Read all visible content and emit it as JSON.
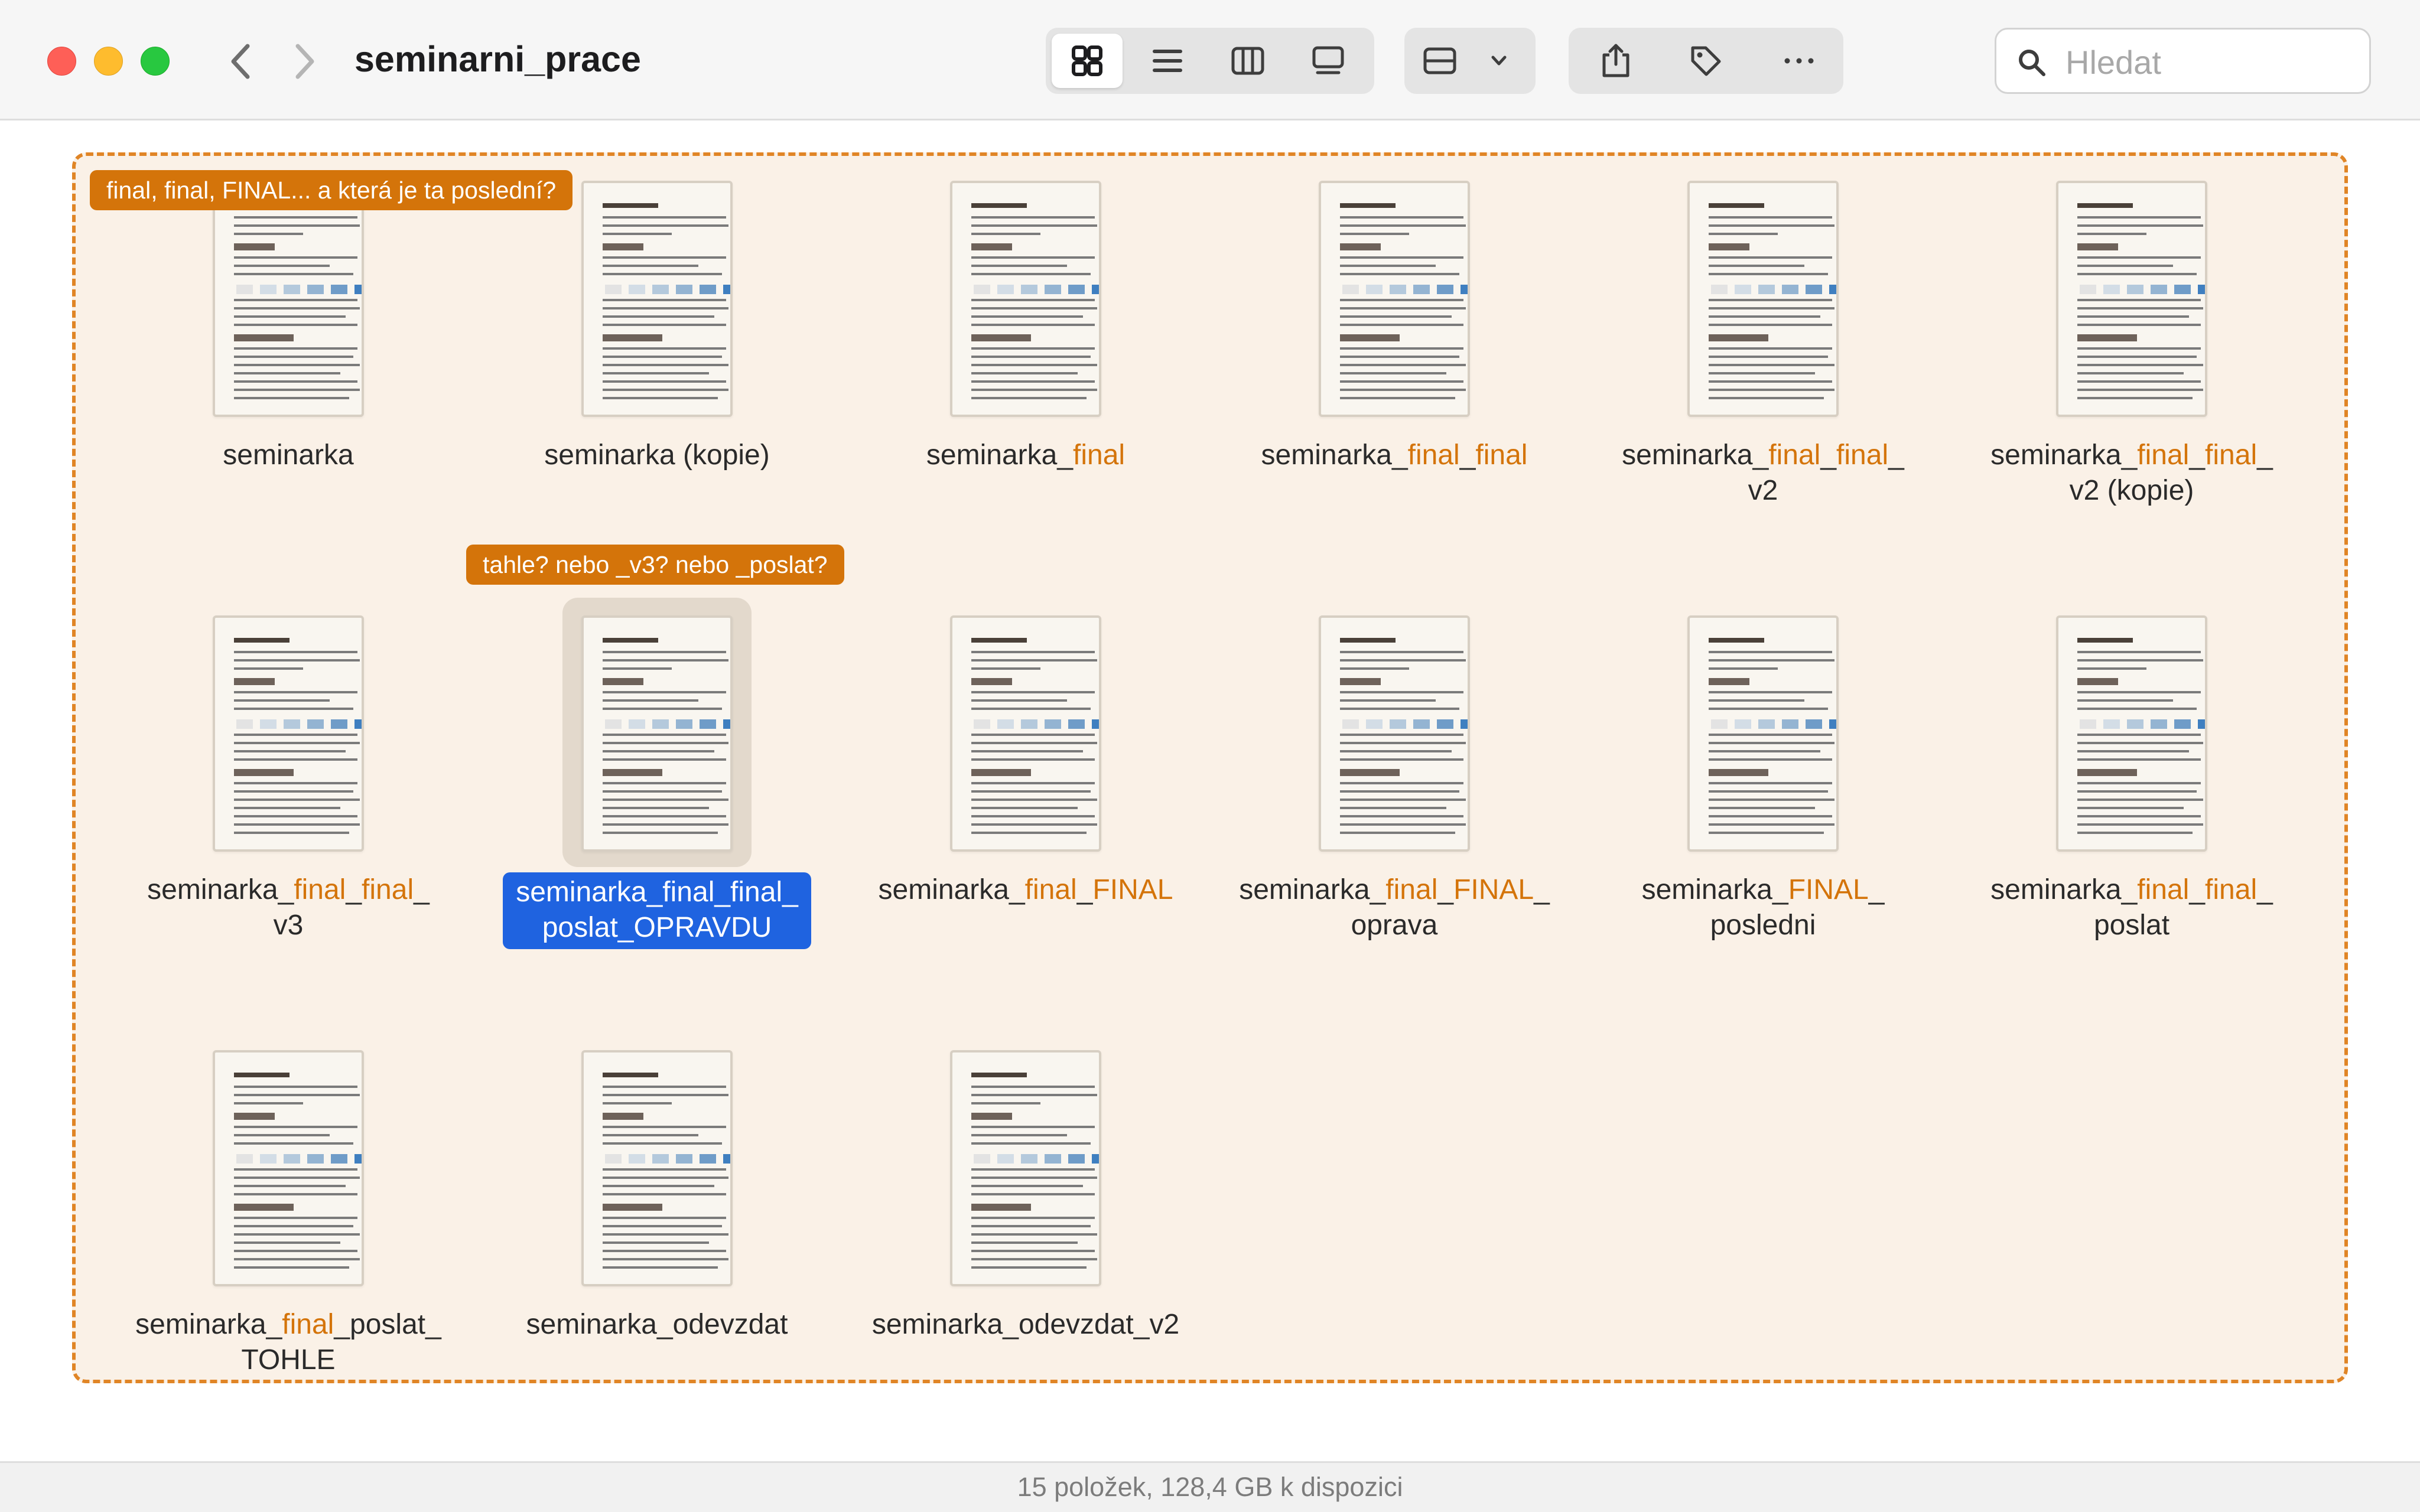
{
  "window": {
    "title": "seminarni_prace",
    "toolbar": {
      "view_buttons": [
        {
          "name": "icon-view",
          "icon": "grid-icon",
          "selected": true
        },
        {
          "name": "list-view",
          "icon": "list-icon",
          "selected": false
        },
        {
          "name": "column-view",
          "icon": "columns-icon",
          "selected": false
        },
        {
          "name": "gallery-view",
          "icon": "gallery-icon",
          "selected": false
        }
      ],
      "group_icon": "group-by-icon",
      "actions": [
        "share-icon",
        "tag-icon",
        "more-icon"
      ]
    },
    "search": {
      "placeholder": "Hledat",
      "value": ""
    }
  },
  "callouts": {
    "top": "final, final, FINAL... a která je ta poslední?",
    "middle": "tahle? nebo _v3? nebo _poslat?"
  },
  "files": [
    {
      "lines": [
        [
          {
            "t": "seminarka",
            "h": false
          }
        ]
      ]
    },
    {
      "lines": [
        [
          {
            "t": "seminarka (kopie)",
            "h": false
          }
        ]
      ]
    },
    {
      "lines": [
        [
          {
            "t": "seminarka_",
            "h": false
          },
          {
            "t": "final",
            "h": true
          }
        ]
      ]
    },
    {
      "lines": [
        [
          {
            "t": "seminarka_",
            "h": false
          },
          {
            "t": "final",
            "h": true
          },
          {
            "t": "_",
            "h": false
          },
          {
            "t": "final",
            "h": true
          }
        ]
      ]
    },
    {
      "lines": [
        [
          {
            "t": "seminarka_",
            "h": false
          },
          {
            "t": "final",
            "h": true
          },
          {
            "t": "_",
            "h": false
          },
          {
            "t": "final",
            "h": true
          },
          {
            "t": "_",
            "h": false
          }
        ],
        [
          {
            "t": "v2",
            "h": false
          }
        ]
      ]
    },
    {
      "lines": [
        [
          {
            "t": "seminarka_",
            "h": false
          },
          {
            "t": "final",
            "h": true
          },
          {
            "t": "_",
            "h": false
          },
          {
            "t": "final",
            "h": true
          },
          {
            "t": "_",
            "h": false
          }
        ],
        [
          {
            "t": "v2 (kopie)",
            "h": false
          }
        ]
      ]
    },
    {
      "lines": [
        [
          {
            "t": "seminarka_",
            "h": false
          },
          {
            "t": "final",
            "h": true
          },
          {
            "t": "_",
            "h": false
          },
          {
            "t": "final",
            "h": true
          },
          {
            "t": "_",
            "h": false
          }
        ],
        [
          {
            "t": "v3",
            "h": false
          }
        ]
      ]
    },
    {
      "lines": [
        [
          {
            "t": "seminarka_final_final_",
            "h": false
          }
        ],
        [
          {
            "t": "poslat_OPRAVDU",
            "h": false
          }
        ]
      ],
      "selected": true
    },
    {
      "lines": [
        [
          {
            "t": "seminarka_",
            "h": false
          },
          {
            "t": "final",
            "h": true
          },
          {
            "t": "_",
            "h": false
          },
          {
            "t": "FINAL",
            "h": true
          }
        ]
      ]
    },
    {
      "lines": [
        [
          {
            "t": "seminarka_",
            "h": false
          },
          {
            "t": "final",
            "h": true
          },
          {
            "t": "_",
            "h": false
          },
          {
            "t": "FINAL",
            "h": true
          },
          {
            "t": "_",
            "h": false
          }
        ],
        [
          {
            "t": "oprava",
            "h": false
          }
        ]
      ]
    },
    {
      "lines": [
        [
          {
            "t": "seminarka_",
            "h": false
          },
          {
            "t": "FINAL",
            "h": true
          },
          {
            "t": "_",
            "h": false
          }
        ],
        [
          {
            "t": "posledni",
            "h": false
          }
        ]
      ]
    },
    {
      "lines": [
        [
          {
            "t": "seminarka_",
            "h": false
          },
          {
            "t": "final",
            "h": true
          },
          {
            "t": "_",
            "h": false
          },
          {
            "t": "final",
            "h": true
          },
          {
            "t": "_",
            "h": false
          }
        ],
        [
          {
            "t": "poslat",
            "h": false
          }
        ]
      ]
    },
    {
      "lines": [
        [
          {
            "t": "seminarka_",
            "h": false
          },
          {
            "t": "final",
            "h": true
          },
          {
            "t": "_poslat_",
            "h": false
          }
        ],
        [
          {
            "t": "TOHLE",
            "h": false
          }
        ]
      ]
    },
    {
      "lines": [
        [
          {
            "t": "seminarka_odevzdat",
            "h": false
          }
        ]
      ]
    },
    {
      "lines": [
        [
          {
            "t": "seminarka_odevzdat_v2",
            "h": false
          }
        ]
      ]
    }
  ],
  "status": "15 položek, 128,4 GB k dispozici",
  "colors": {
    "accent_orange": "#d4740a",
    "selection_blue": "#1f63e0",
    "region_fill": "#faf1e7",
    "doc_blocks": [
      "#e3e3e3",
      "#d3dde6",
      "#b4c9dc",
      "#94b4d2",
      "#6f9cc8",
      "#3f7fc0"
    ]
  }
}
